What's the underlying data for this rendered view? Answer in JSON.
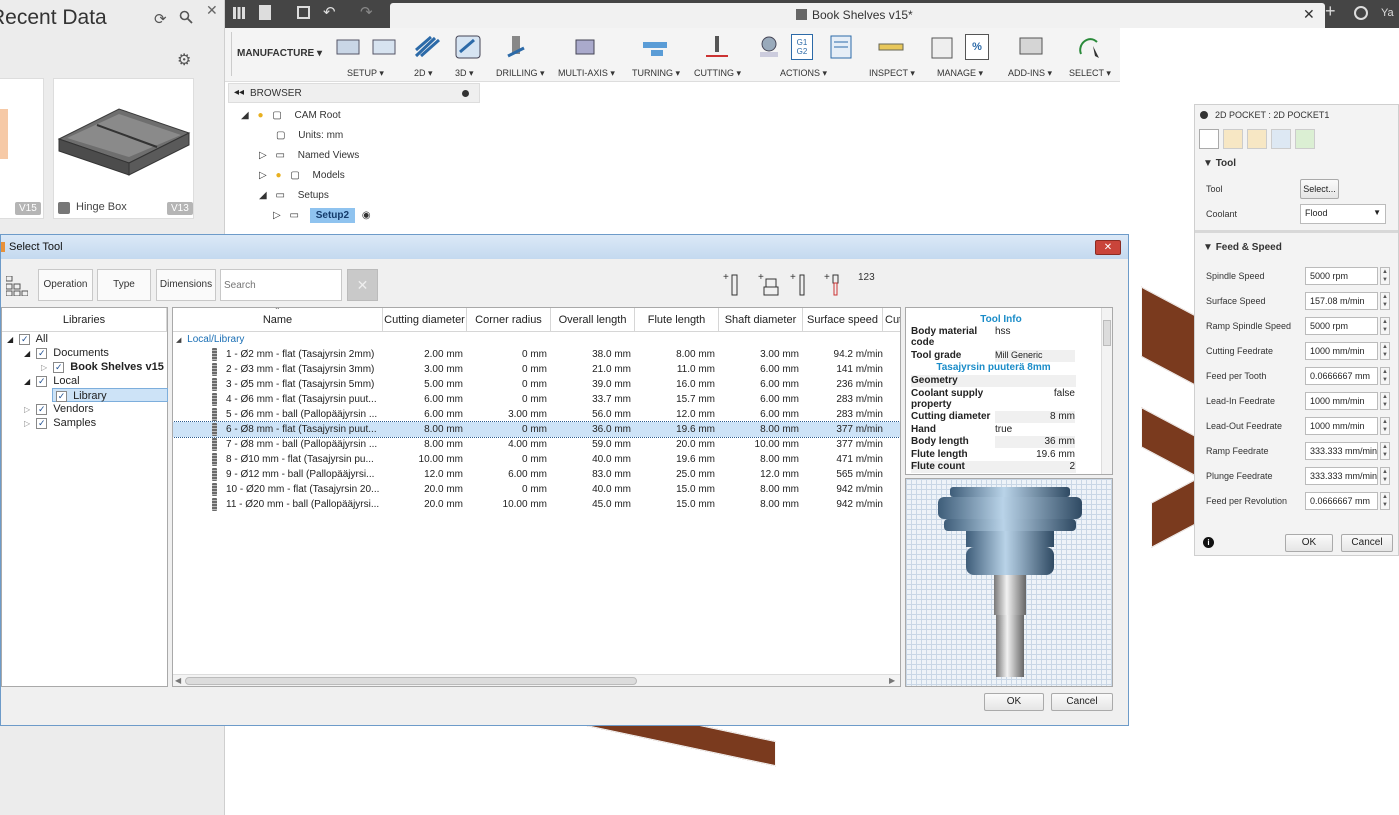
{
  "data_panel": {
    "title": "Recent Data",
    "cards": [
      {
        "version": "V15"
      },
      {
        "name": "Hinge Box",
        "version": "V13"
      }
    ]
  },
  "app_bar": {
    "document_title": "Book Shelves v15*",
    "user_initials": "Ya"
  },
  "ribbon": {
    "workspace": "MANUFACTURE",
    "groups": [
      "SETUP",
      "2D",
      "3D",
      "DRILLING",
      "MULTI-AXIS",
      "TURNING",
      "CUTTING",
      "ACTIONS",
      "INSPECT",
      "MANAGE",
      "ADD-INS",
      "SELECT"
    ],
    "g1g2_label_top": "G1",
    "g1g2_label_bottom": "G2",
    "percent_label": "%"
  },
  "browser": {
    "header": "BROWSER",
    "items": [
      {
        "label": "CAM Root"
      },
      {
        "label": "Units: mm"
      },
      {
        "label": "Named Views"
      },
      {
        "label": "Models"
      },
      {
        "label": "Setups"
      },
      {
        "label": "Setup2"
      }
    ]
  },
  "right_panel": {
    "title": "2D POCKET : 2D POCKET1",
    "tool_section": "Tool",
    "tool_label": "Tool",
    "tool_button": "Select...",
    "coolant_label": "Coolant",
    "coolant_value": "Flood",
    "feed_section": "Feed & Speed",
    "fields": [
      {
        "label": "Spindle Speed",
        "value": "5000 rpm"
      },
      {
        "label": "Surface Speed",
        "value": "157.08 m/min"
      },
      {
        "label": "Ramp Spindle Speed",
        "value": "5000 rpm"
      },
      {
        "label": "Cutting Feedrate",
        "value": "1000 mm/min"
      },
      {
        "label": "Feed per Tooth",
        "value": "0.0666667 mm"
      },
      {
        "label": "Lead-In Feedrate",
        "value": "1000 mm/min"
      },
      {
        "label": "Lead-Out Feedrate",
        "value": "1000 mm/min"
      },
      {
        "label": "Ramp Feedrate",
        "value": "333.333 mm/min"
      },
      {
        "label": "Plunge Feedrate",
        "value": "333.333 mm/min"
      },
      {
        "label": "Feed per Revolution",
        "value": "0.0666667 mm"
      }
    ],
    "ok": "OK",
    "cancel": "Cancel"
  },
  "dialog": {
    "title": "Select Tool",
    "filter_buttons": [
      "Operation",
      "Type",
      "Dimensions"
    ],
    "search_placeholder": "Search",
    "numbering_label": "123",
    "libraries_header": "Libraries",
    "libraries": [
      {
        "label": "All"
      },
      {
        "label": "Documents"
      },
      {
        "label": "Book Shelves v15"
      },
      {
        "label": "Local"
      },
      {
        "label": "Library"
      },
      {
        "label": "Vendors"
      },
      {
        "label": "Samples"
      }
    ],
    "columns": [
      "Name",
      "Cutting diameter",
      "Corner radius",
      "Overall length",
      "Flute length",
      "Shaft diameter",
      "Surface speed",
      "Cut"
    ],
    "group_label": "Local/Library",
    "selected_index": 5,
    "rows": [
      {
        "name": "1 - Ø2 mm - flat (Tasajyrsin 2mm)",
        "cutting_diameter": "2.00 mm",
        "corner_radius": "0 mm",
        "overall_length": "38.0 mm",
        "flute_length": "8.00 mm",
        "shaft_diameter": "3.00 mm",
        "surface_speed": "94.2 m/min"
      },
      {
        "name": "2 - Ø3 mm - flat (Tasajyrsin 3mm)",
        "cutting_diameter": "3.00 mm",
        "corner_radius": "0 mm",
        "overall_length": "21.0 mm",
        "flute_length": "11.0 mm",
        "shaft_diameter": "6.00 mm",
        "surface_speed": "141 m/min"
      },
      {
        "name": "3 - Ø5 mm - flat (Tasajyrsin 5mm)",
        "cutting_diameter": "5.00 mm",
        "corner_radius": "0 mm",
        "overall_length": "39.0 mm",
        "flute_length": "16.0 mm",
        "shaft_diameter": "6.00 mm",
        "surface_speed": "236 m/min"
      },
      {
        "name": "4 - Ø6 mm - flat (Tasajyrsin puut...",
        "cutting_diameter": "6.00 mm",
        "corner_radius": "0 mm",
        "overall_length": "33.7 mm",
        "flute_length": "15.7 mm",
        "shaft_diameter": "6.00 mm",
        "surface_speed": "283 m/min"
      },
      {
        "name": "5 - Ø6 mm - ball (Pallopääjyrsin ...",
        "cutting_diameter": "6.00 mm",
        "corner_radius": "3.00 mm",
        "overall_length": "56.0 mm",
        "flute_length": "12.0 mm",
        "shaft_diameter": "6.00 mm",
        "surface_speed": "283 m/min"
      },
      {
        "name": "6 - Ø8 mm - flat (Tasajyrsin puut...",
        "cutting_diameter": "8.00 mm",
        "corner_radius": "0 mm",
        "overall_length": "36.0 mm",
        "flute_length": "19.6 mm",
        "shaft_diameter": "8.00 mm",
        "surface_speed": "377 m/min"
      },
      {
        "name": "7 - Ø8 mm - ball (Pallopääjyrsin ...",
        "cutting_diameter": "8.00 mm",
        "corner_radius": "4.00 mm",
        "overall_length": "59.0 mm",
        "flute_length": "20.0 mm",
        "shaft_diameter": "10.00 mm",
        "surface_speed": "377 m/min"
      },
      {
        "name": "8 - Ø10 mm - flat (Tasajyrsin pu...",
        "cutting_diameter": "10.00 mm",
        "corner_radius": "0 mm",
        "overall_length": "40.0 mm",
        "flute_length": "19.6 mm",
        "shaft_diameter": "8.00 mm",
        "surface_speed": "471 m/min"
      },
      {
        "name": "9 - Ø12 mm - ball (Pallopääjyrsi...",
        "cutting_diameter": "12.0 mm",
        "corner_radius": "6.00 mm",
        "overall_length": "83.0 mm",
        "flute_length": "25.0 mm",
        "shaft_diameter": "12.0 mm",
        "surface_speed": "565 m/min"
      },
      {
        "name": "10 - Ø20 mm - flat (Tasajyrsin 20...",
        "cutting_diameter": "20.0 mm",
        "corner_radius": "0 mm",
        "overall_length": "40.0 mm",
        "flute_length": "15.0 mm",
        "shaft_diameter": "8.00 mm",
        "surface_speed": "942 m/min"
      },
      {
        "name": "11 - Ø20 mm - ball (Pallopääjyrsi...",
        "cutting_diameter": "20.0 mm",
        "corner_radius": "10.00 mm",
        "overall_length": "45.0 mm",
        "flute_length": "15.0 mm",
        "shaft_diameter": "8.00 mm",
        "surface_speed": "942 m/min"
      }
    ],
    "tool_info": {
      "header": "Tool Info",
      "tool_name": "Tasajyrsin puuterä 8mm",
      "body_material_label": "Body material code",
      "body_material": "hss",
      "tool_grade_label": "Tool grade",
      "tool_grade": "Mill Generic",
      "geometry_label": "Geometry",
      "coolant_supply_label": "Coolant supply property",
      "coolant_supply": "false",
      "cutting_diameter_label": "Cutting diameter",
      "cutting_diameter": "8 mm",
      "hand_label": "Hand",
      "hand": "true",
      "body_length_label": "Body length",
      "body_length": "36 mm",
      "flute_length_label": "Flute length",
      "flute_length": "19.6 mm",
      "flute_count_label": "Flute count",
      "flute_count": "2"
    },
    "ok": "OK",
    "cancel": "Cancel"
  },
  "colors": {
    "accent_blue": "#1a6fb5",
    "selection": "#cde3f7",
    "wood": "#7a3a1e",
    "titlebar": "#454545"
  }
}
